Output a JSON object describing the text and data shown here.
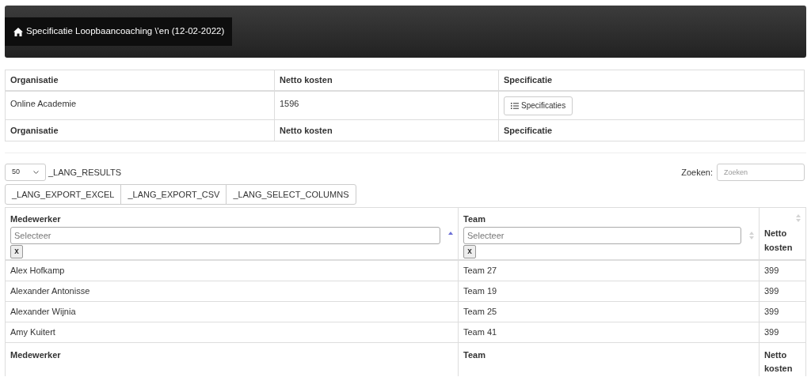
{
  "header": {
    "title": "Specificatie Loopbaancoaching \\'en (12-02-2022)"
  },
  "summary_table": {
    "columns": [
      "Organisatie",
      "Netto kosten",
      "Specificatie"
    ],
    "rows": [
      {
        "organisatie": "Online Academie",
        "netto_kosten": "1596",
        "button": "Specificaties"
      }
    ],
    "footer": [
      "Organisatie",
      "Netto kosten",
      "Specificatie"
    ]
  },
  "length_select": {
    "value": "50",
    "label": "_LANG_RESULTS"
  },
  "search": {
    "label": "Zoeken:",
    "placeholder": "Zoeken"
  },
  "export_buttons": [
    "_LANG_EXPORT_EXCEL",
    "_LANG_EXPORT_CSV",
    "_LANG_SELECT_COLUMNS"
  ],
  "table": {
    "columns": [
      {
        "label": "Medewerker",
        "filter_placeholder": "Selecteer",
        "clear": "x",
        "sorted": true
      },
      {
        "label": "Team",
        "filter_placeholder": "Selecteer",
        "clear": "x",
        "sorted": false
      },
      {
        "label": "Netto kosten",
        "sorted": false
      }
    ],
    "rows": [
      [
        "Alex Hofkamp",
        "Team 27",
        "399"
      ],
      [
        "Alexander Antonisse",
        "Team 19",
        "399"
      ],
      [
        "Alexander Wijnia",
        "Team 25",
        "399"
      ],
      [
        "Amy Kuitert",
        "Team 41",
        "399"
      ]
    ],
    "footer": [
      "Medewerker",
      "Team",
      "Netto kosten"
    ]
  }
}
